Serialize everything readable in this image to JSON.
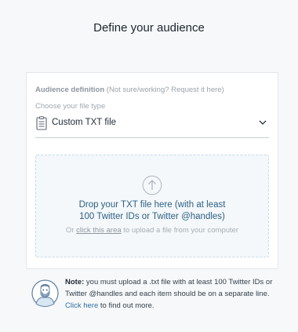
{
  "page": {
    "title": "Define your audience"
  },
  "audience": {
    "label": "Audience definition",
    "hint": "(Not sure/working? Request it here)"
  },
  "file_type": {
    "label": "Choose your file type",
    "selected": "Custom TXT file",
    "icon": "file-list-icon"
  },
  "dropzone": {
    "icon": "upload-arrow-icon",
    "line1": "Drop your TXT file here (with at least",
    "line2": "100 Twitter IDs or Twitter @handles)",
    "sub_prefix": "Or ",
    "sub_link": "click this area",
    "sub_suffix": " to upload a file from your computer"
  },
  "note": {
    "avatar_icon": "avatar-icon",
    "label": "Note:",
    "body": " you must upload a .txt file with at least 100 Twitter IDs or Twitter @handles and each item should be on a separate line.",
    "link": "Click here",
    "link_suffix": " to find out more."
  },
  "colors": {
    "accent": "#2f6ea3",
    "dropzone_text": "#2d5f83",
    "dropzone_bg": "#f4f8fb",
    "page_bg": "#f7f8f9"
  }
}
